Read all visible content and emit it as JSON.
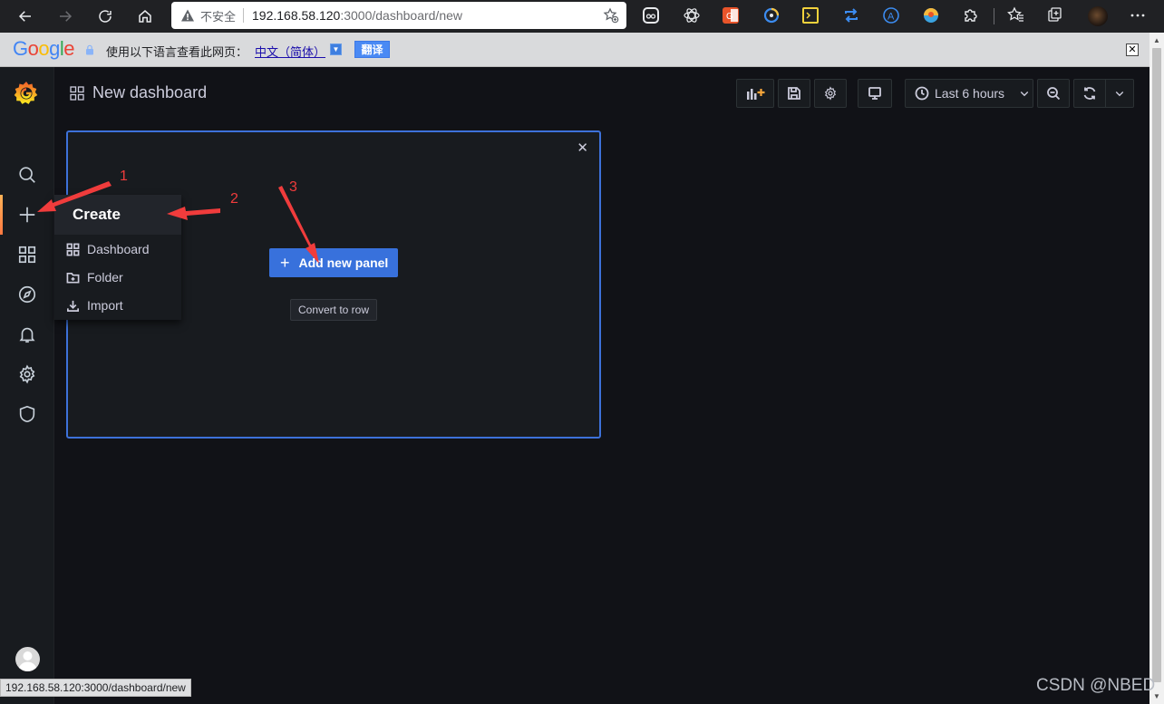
{
  "browser": {
    "insecure_label": "不安全",
    "url_host": "192.168.58.120",
    "url_path": ":3000/dashboard/new"
  },
  "translate_bar": {
    "logo": "Google",
    "prompt": "使用以下语言查看此网页：",
    "language": "中文（简体）",
    "translate_button": "翻译",
    "close_label": "✕"
  },
  "header": {
    "title": "New dashboard",
    "time_range": "Last 6 hours"
  },
  "panel": {
    "add_panel_label": "Add new panel",
    "convert_to_row_label": "Convert to row",
    "close_label": "✕"
  },
  "create_menu": {
    "title": "Create",
    "items": [
      {
        "label": "Dashboard",
        "icon": "apps-icon"
      },
      {
        "label": "Folder",
        "icon": "folder-plus-icon"
      },
      {
        "label": "Import",
        "icon": "import-icon"
      }
    ]
  },
  "annotations": {
    "labels": [
      "1",
      "2",
      "3"
    ],
    "color": "#f03c3c"
  },
  "status_url": "192.168.58.120:3000/dashboard/new",
  "watermark": "CSDN @NBED",
  "colors": {
    "grafana_bg": "#111217",
    "sidebar_bg": "#181b1f",
    "primary_button": "#3871dc",
    "panel_border": "#3d71d9",
    "active_gradient": [
      "#ffb357",
      "#ff7941"
    ]
  }
}
